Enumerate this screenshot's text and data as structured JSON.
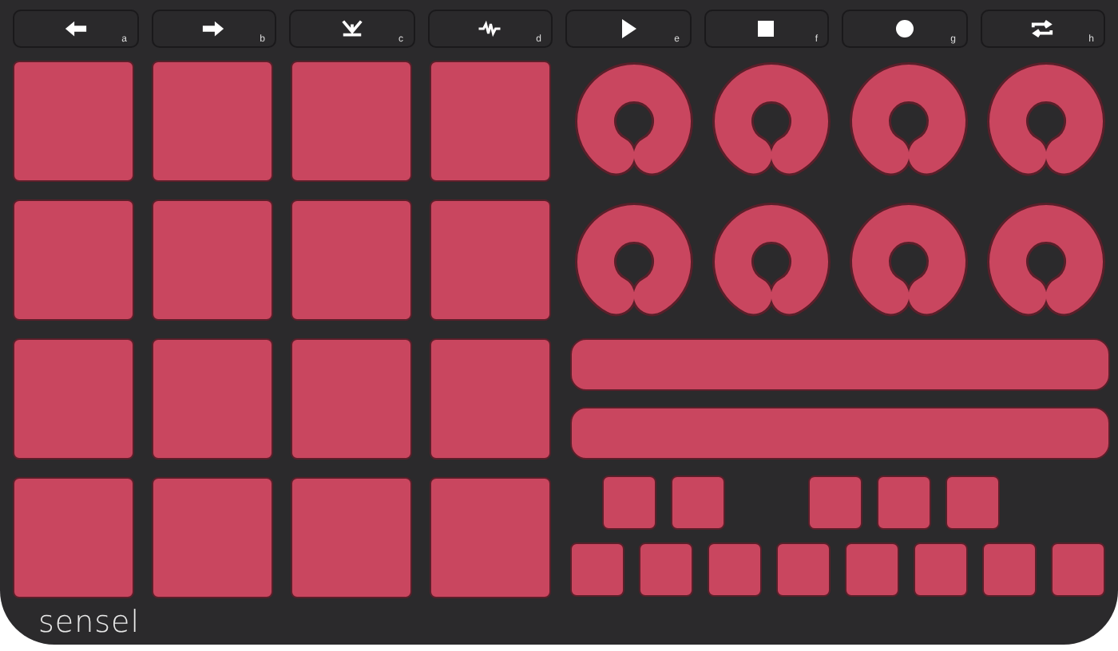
{
  "function_keys": [
    {
      "letter": "a"
    },
    {
      "letter": "b"
    },
    {
      "letter": "c"
    },
    {
      "letter": "d"
    },
    {
      "letter": "e"
    },
    {
      "letter": "f"
    },
    {
      "letter": "g"
    },
    {
      "letter": "h"
    }
  ],
  "brand": "sensel"
}
